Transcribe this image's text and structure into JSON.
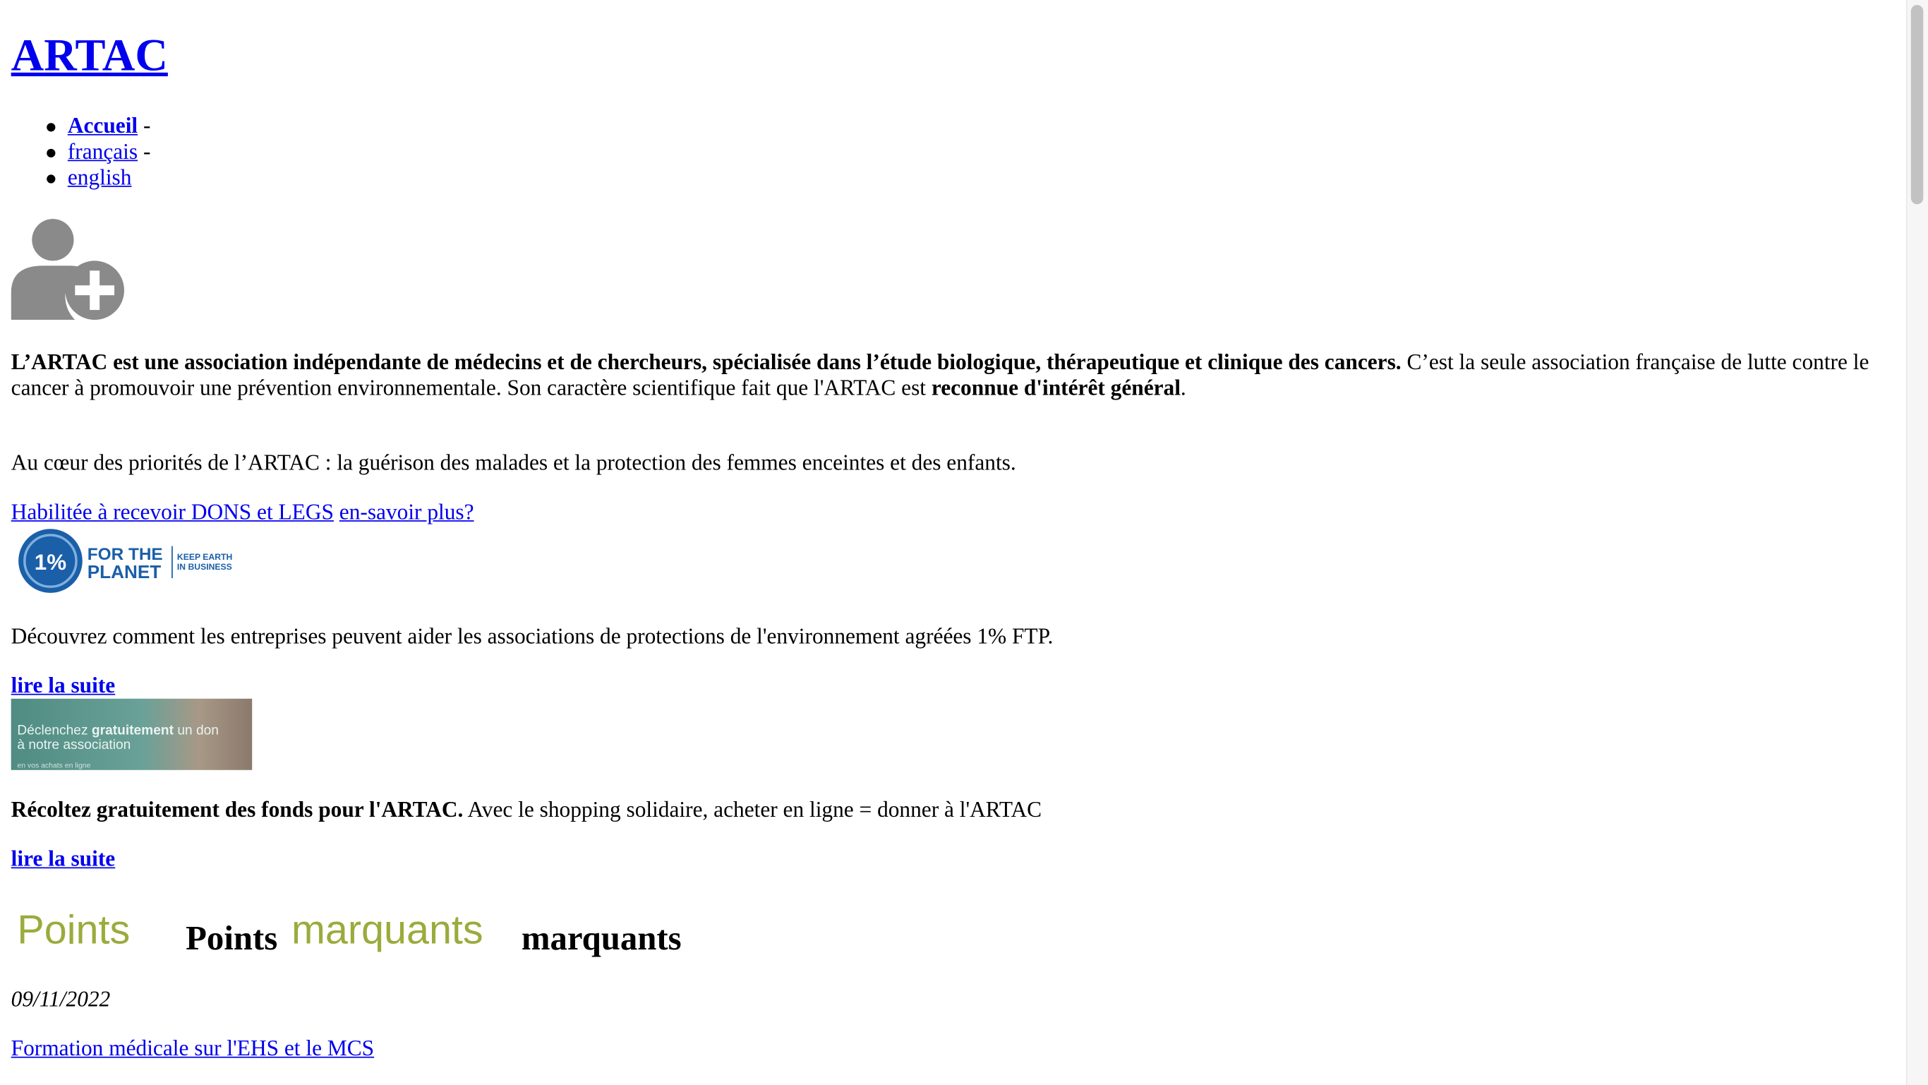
{
  "site": {
    "title": "ARTAC"
  },
  "nav": [
    {
      "label": "Accueil",
      "sep": " -"
    },
    {
      "label": "français",
      "sep": " -"
    },
    {
      "label": "english",
      "sep": ""
    }
  ],
  "intro": {
    "bold_part": "L’ARTAC est une association indépendante de médecins et de chercheurs, spécialisée dans l’étude biologique, thérapeutique et clinique des cancers.",
    "rest_part": " C’est la seule association française de lutte contre le cancer à promouvoir une prévention environnementale. Son caractère scientifique fait que l'ARTAC est ",
    "bold_end": "reconnue d'intérêt général",
    "period": "."
  },
  "priorities": "Au cœur des priorités de l’ARTAC : la guérison des malades et la protection des femmes enceintes et des enfants.",
  "donations": {
    "link1": "Habilitée à recevoir DONS et LEGS",
    "link2": "en-savoir plus?"
  },
  "ftp": {
    "logo_main": "1%",
    "logo_text1": "FOR THE",
    "logo_text2": "PLANET",
    "logo_tag1": "KEEP EARTH",
    "logo_tag2": "IN BUSINESS",
    "text": "Découvrez comment les entreprises peuvent aider les associations de protections de l'environnement agréées 1% FTP.",
    "more": "lire la suite"
  },
  "shopping": {
    "banner_line1_a": "Déclenchez ",
    "banner_line1_b": "gratuitement",
    "banner_line1_c": " un don",
    "banner_line2": "à notre association",
    "banner_tiny": "en vos achats en ligne",
    "bold": "Récoltez gratuitement des fonds pour l'ARTAC.",
    "text": " Avec le shopping solidaire, acheter en ligne = donner à l'ARTAC",
    "more": "lire la suite"
  },
  "highlights": {
    "logo_word1": "Points",
    "heading_word1": "Points",
    "logo_word2": "marquants",
    "heading_word2": "marquants"
  },
  "news": {
    "date": "09/11/2022",
    "title": "Formation médicale sur l'EHS et le MCS"
  },
  "colors": {
    "link": "#0000ee",
    "highlight_green": "#9bab3c",
    "ftp_blue": "#1a5fa8",
    "icon_grey": "#8a8a8a"
  }
}
